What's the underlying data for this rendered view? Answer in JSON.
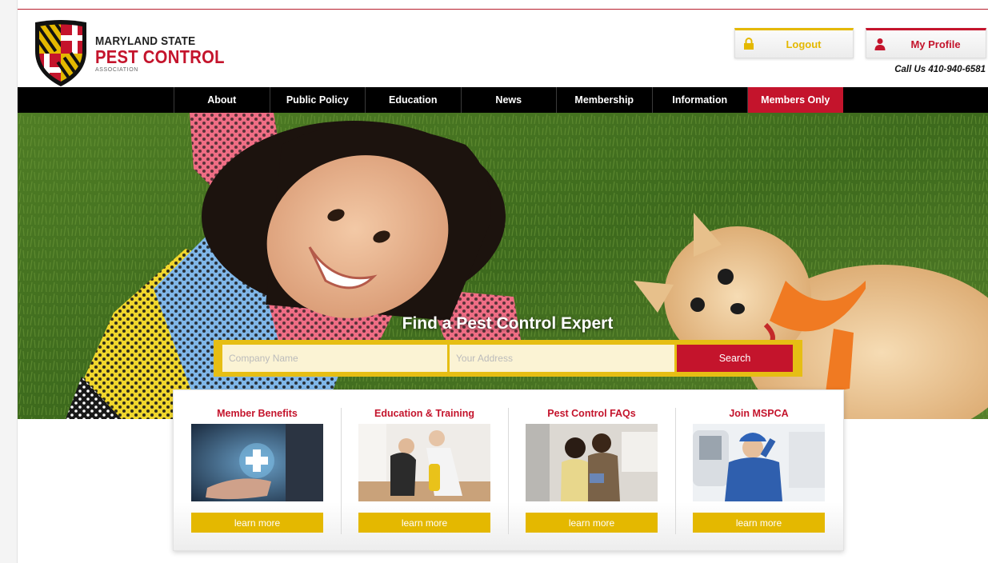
{
  "brand": {
    "line1": "MARYLAND STATE",
    "line2": "PEST CONTROL",
    "line3": "ASSOCIATION"
  },
  "header": {
    "logout_label": "Logout",
    "profile_label": "My Profile",
    "phone": "Call Us 410-940-6581"
  },
  "nav": {
    "items": [
      {
        "label": "About"
      },
      {
        "label": "Public Policy"
      },
      {
        "label": "Education"
      },
      {
        "label": "News"
      },
      {
        "label": "Membership"
      },
      {
        "label": "Information"
      },
      {
        "label": "Members Only"
      }
    ],
    "active": "Members Only"
  },
  "hero": {
    "title": "Find a Pest Control Expert",
    "company_placeholder": "Company Name",
    "address_placeholder": "Your Address",
    "search_label": "Search"
  },
  "cards": [
    {
      "title": "Member Benefits",
      "button": "learn more"
    },
    {
      "title": "Education & Training",
      "button": "learn more"
    },
    {
      "title": "Pest Control FAQs",
      "button": "learn more"
    },
    {
      "title": "Join MSPCA",
      "button": "learn more"
    }
  ],
  "colors": {
    "brand_red": "#c4142c",
    "brand_gold": "#e4b800",
    "nav_bg": "#000000"
  },
  "icons": {
    "logout": "lock-icon",
    "profile": "user-icon"
  }
}
